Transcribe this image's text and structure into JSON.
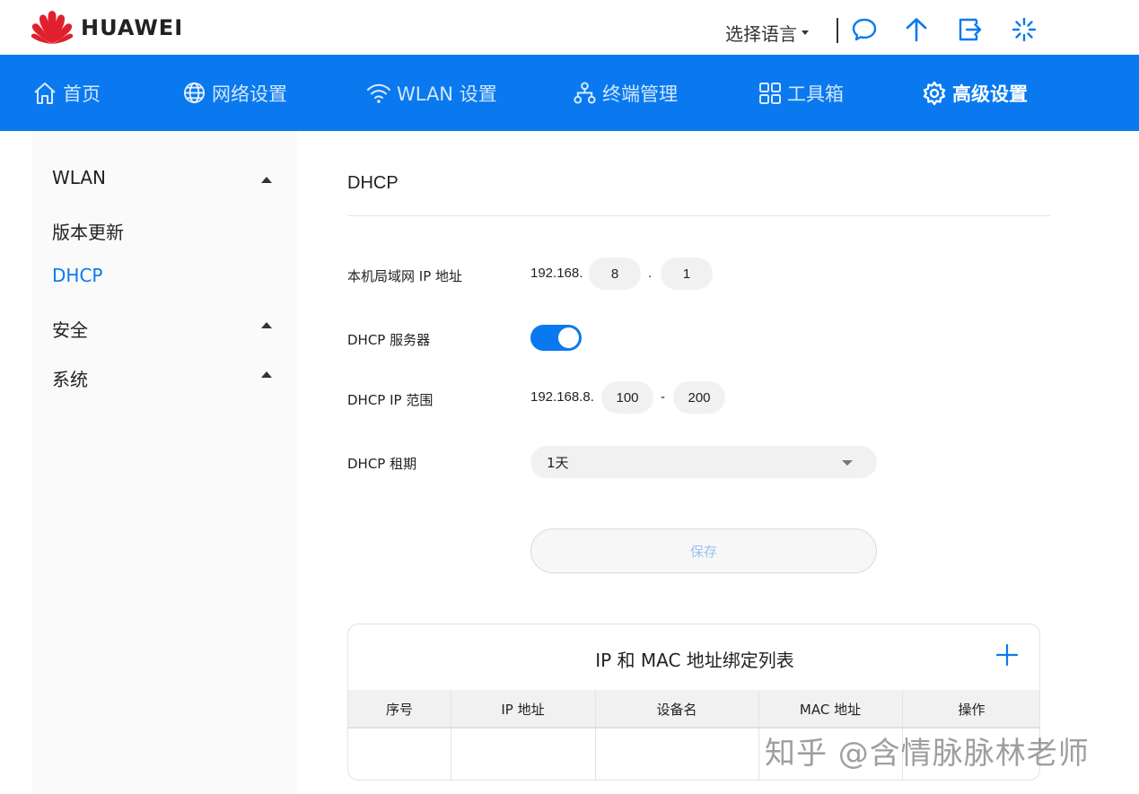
{
  "header": {
    "brand": "HUAWEI",
    "language_label": "选择语言",
    "icons": [
      "chat-icon",
      "upload-arrow-icon",
      "logout-icon",
      "loading-icon"
    ]
  },
  "nav": {
    "items": [
      {
        "label": "首页",
        "icon": "home-icon"
      },
      {
        "label": "网络设置",
        "icon": "globe-icon"
      },
      {
        "label": "WLAN 设置",
        "icon": "wifi-icon"
      },
      {
        "label": "终端管理",
        "icon": "devices-icon"
      },
      {
        "label": "工具箱",
        "icon": "grid-icon"
      },
      {
        "label": "高级设置",
        "icon": "gear-icon"
      }
    ],
    "active": "高级设置"
  },
  "sidebar": {
    "items": [
      {
        "label": "WLAN",
        "expandable": true
      },
      {
        "label": "版本更新",
        "expandable": false
      },
      {
        "label": "DHCP",
        "expandable": false,
        "active": true
      },
      {
        "label": "安全",
        "expandable": true
      },
      {
        "label": "系统",
        "expandable": true
      }
    ]
  },
  "main": {
    "title": "DHCP",
    "lan_ip": {
      "label": "本机局域网 IP 地址",
      "prefix": "192.168.",
      "octet3": "8",
      "dot": ".",
      "octet4": "1"
    },
    "dhcp_server": {
      "label": "DHCP 服务器",
      "enabled": true
    },
    "ip_range": {
      "label": "DHCP IP 范围",
      "prefix": "192.168.8.",
      "start": "100",
      "dash": "-",
      "end": "200"
    },
    "lease": {
      "label": "DHCP 租期",
      "value": "1天"
    },
    "save_label": "保存"
  },
  "binding_table": {
    "title": "IP 和 MAC 地址绑定列表",
    "columns": [
      "序号",
      "IP 地址",
      "设备名",
      "MAC 地址",
      "操作"
    ],
    "rows": []
  },
  "watermark": "知乎 @含情脉脉林老师",
  "colors": {
    "accent": "#0a79ef",
    "brand_red": "#e0202d"
  }
}
